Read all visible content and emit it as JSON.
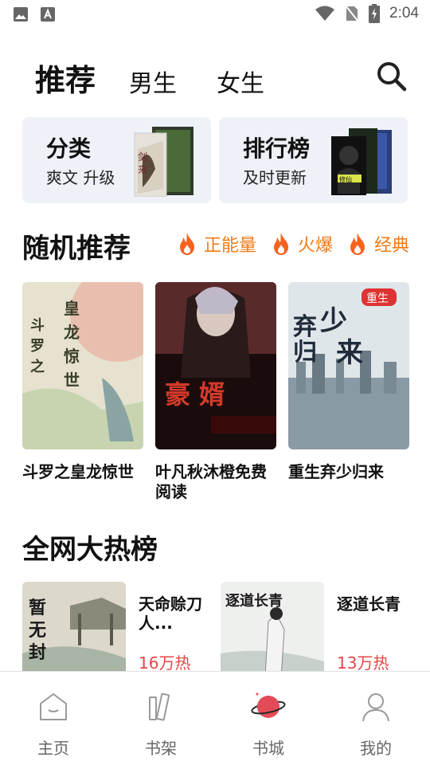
{
  "status_bar": {
    "time": "2:04"
  },
  "top_tabs": {
    "recommend": "推荐",
    "male": "男生",
    "female": "女生"
  },
  "cards": [
    {
      "title": "分类",
      "subtitle": "爽文 升级"
    },
    {
      "title": "排行榜",
      "subtitle": "及时更新"
    }
  ],
  "random_section": {
    "title": "随机推荐",
    "filters": [
      "正能量",
      "火爆",
      "经典"
    ]
  },
  "random_books": [
    {
      "title": "斗罗之皇龙惊世",
      "cover_text": "斗罗之皇龙惊世"
    },
    {
      "title": "叶凡秋沐橙免费阅读",
      "cover_text": "豪婿"
    },
    {
      "title": "重生弃少归来",
      "cover_text": "弃少归来"
    }
  ],
  "hot_section": {
    "title": "全网大热榜"
  },
  "hot_books": [
    {
      "title": "天命赊刀人...",
      "heat": "16万热",
      "cover_text": "暂无封面"
    },
    {
      "title": "逐道长青",
      "heat": "13万热",
      "cover_text": "逐道长青"
    }
  ],
  "bottom_nav": [
    "主页",
    "书架",
    "书城",
    "我的"
  ],
  "colors": {
    "accent": "#f07a16",
    "heat": "#e64545",
    "card_bg": "#eef2f8",
    "active_nav": "#e34c57"
  }
}
